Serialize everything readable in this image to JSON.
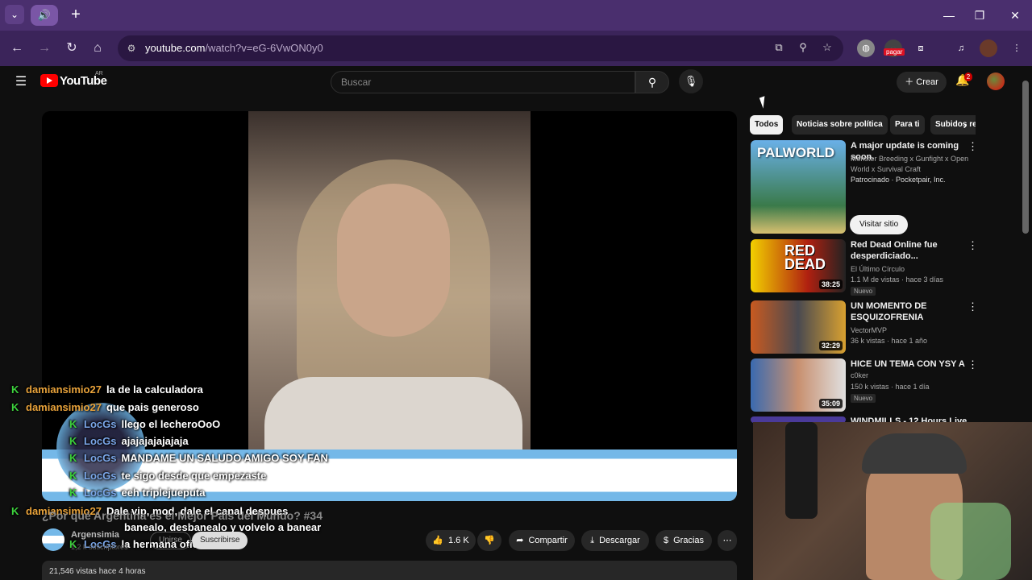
{
  "browser": {
    "tab_dropdown_icon": "chevron-down-icon",
    "tab_audio_icon": "speaker-icon",
    "new_tab_icon": "plus-icon",
    "url_domain": "youtube.com",
    "url_path": "/watch?v=eG-6VwON0y0",
    "pagar_badge": "pagar"
  },
  "youtube": {
    "logo_text": "YouTube",
    "country": "AR",
    "search_placeholder": "Buscar",
    "create_label": "Crear",
    "notification_count": "2"
  },
  "chat": [
    {
      "user": "damiansimio27",
      "msg": "la de la calculadora",
      "user_color": "orange"
    },
    {
      "user": "damiansimio27",
      "msg": "que pais generoso",
      "user_color": "orange"
    },
    {
      "user": "LocGs",
      "msg": "llego el lecheroOoO",
      "user_color": "blue"
    },
    {
      "user": "LocGs",
      "msg": "ajajajajajajaja",
      "user_color": "blue"
    },
    {
      "user": "LocGs",
      "msg": "MANDAME UN SALUDO AMIGO SOY FAN",
      "user_color": "blue"
    },
    {
      "user": "LocGs",
      "msg": "te sigo desde que empezaste",
      "user_color": "blue"
    },
    {
      "user": "LocGs",
      "msg": "eeh triplejueputa",
      "user_color": "blue"
    },
    {
      "user": "damiansimio27",
      "msg": "Dale vip, mod, dale el canal despues",
      "user_color": "orange"
    },
    {
      "user": "",
      "msg": "banealo, desbanealo y volvelo a banear",
      "user_color": "orange"
    },
    {
      "user": "LocGs",
      "msg": "la hermana oficial",
      "user_color": "blue"
    }
  ],
  "video": {
    "title": "¿Por qué Argentina es el Mejor País del Mundo? #34",
    "channel": "Argensimia",
    "subscribers": "1,2 k suscriptores",
    "join_label": "Unirse",
    "subscribe_label": "Suscribirse",
    "likes": "1.6 K",
    "share_label": "Compartir",
    "download_label": "Descargar",
    "thanks_label": "Gracias",
    "views_time": "21,546 vistas  hace 4 horas"
  },
  "chips": [
    "Todos",
    "Noticias sobre política",
    "Para ti",
    "Subidos recientemente"
  ],
  "recommendations": [
    {
      "title": "A major update is coming soon.",
      "meta1": "Monster Breeding x Gunfight x Open World x Survival Craft",
      "meta2": "Patrocinado · Pocketpair, Inc.",
      "button": "Visitar sitio",
      "thumb_text": "PALWORLD"
    },
    {
      "title": "Red Dead Online fue desperdiciado...",
      "channel": "El Último Círculo",
      "meta": "1.1 M de vistas · hace 3 días",
      "badge": "Nuevo",
      "duration": "38:25",
      "thumb_text": "RED DEAD"
    },
    {
      "title": "UN MOMENTO DE ESQUIZOFRENIA",
      "channel": "VectorMVP",
      "meta": "36 k vistas · hace 1 año",
      "duration": "32:29"
    },
    {
      "title": "HICE UN TEMA CON YSY A",
      "channel": "c0ker",
      "meta": "150 k vistas · hace 1 día",
      "badge": "Nuevo",
      "duration": "35:09"
    },
    {
      "title": "WINDMILLS - 12 Hours Live"
    }
  ]
}
